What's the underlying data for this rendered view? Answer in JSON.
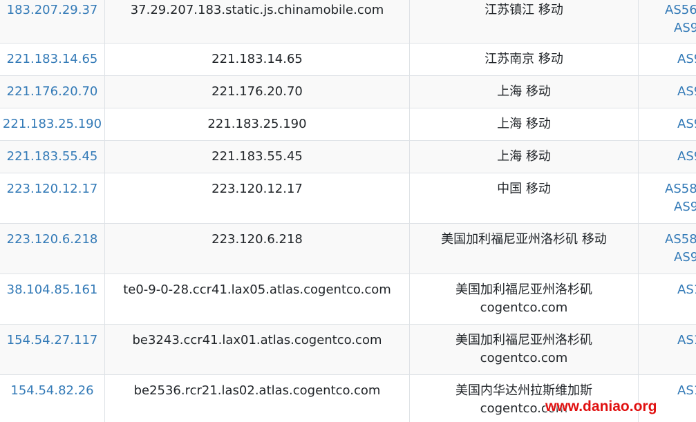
{
  "rows": [
    {
      "ip": "183.207.29.37",
      "host": "37.29.207.183.static.js.chinamobile.com",
      "location": [
        "江苏镇江 移动"
      ],
      "asn": [
        "AS56",
        "AS9"
      ]
    },
    {
      "ip": "221.183.14.65",
      "host": "221.183.14.65",
      "location": [
        "江苏南京 移动"
      ],
      "asn": [
        "AS9"
      ]
    },
    {
      "ip": "221.176.20.70",
      "host": "221.176.20.70",
      "location": [
        "上海 移动"
      ],
      "asn": [
        "AS9"
      ]
    },
    {
      "ip": "221.183.25.190",
      "host": "221.183.25.190",
      "location": [
        "上海 移动"
      ],
      "asn": [
        "AS9"
      ]
    },
    {
      "ip": "221.183.55.45",
      "host": "221.183.55.45",
      "location": [
        "上海 移动"
      ],
      "asn": [
        "AS9"
      ]
    },
    {
      "ip": "223.120.12.17",
      "host": "223.120.12.17",
      "location": [
        "中国 移动"
      ],
      "asn": [
        "AS58",
        "AS9"
      ]
    },
    {
      "ip": "223.120.6.218",
      "host": "223.120.6.218",
      "location": [
        "美国加利福尼亚州洛杉矶 移动"
      ],
      "asn": [
        "AS58",
        "AS9"
      ]
    },
    {
      "ip": "38.104.85.161",
      "host": "te0-9-0-28.ccr41.lax05.atlas.cogentco.com",
      "location": [
        "美国加利福尼亚州洛杉矶",
        "cogentco.com"
      ],
      "asn": [
        "AS1"
      ]
    },
    {
      "ip": "154.54.27.117",
      "host": "be3243.ccr41.lax01.atlas.cogentco.com",
      "location": [
        "美国加利福尼亚州洛杉矶",
        "cogentco.com"
      ],
      "asn": [
        "AS1"
      ]
    },
    {
      "ip": "154.54.82.26",
      "host": "be2536.rcr21.las02.atlas.cogentco.com",
      "location": [
        "美国内华达州拉斯维加斯",
        "cogentco.com"
      ],
      "asn": [
        "AS1"
      ]
    }
  ],
  "watermark": "www.daniao.org",
  "colors": {
    "link": "#337ab7",
    "text": "#212529",
    "border": "#dee2e6",
    "stripe": "#f9f9f9",
    "watermark": "#e01010"
  }
}
